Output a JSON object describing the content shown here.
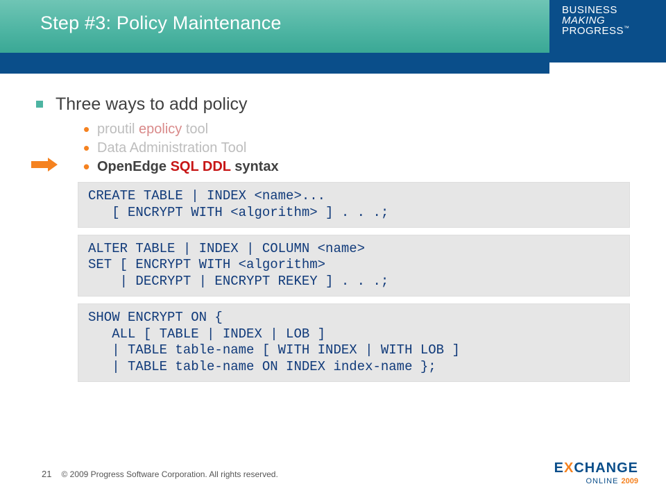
{
  "header": {
    "title": "Step #3: Policy Maintenance",
    "logo_line1": "BUSINESS",
    "logo_line2": "MAKING",
    "logo_line3": "PROGRESS",
    "logo_tm": "™"
  },
  "bullets": {
    "lvl1": "Three ways to add policy",
    "item1_pre": "proutil ",
    "item1_red": "epolicy",
    "item1_post": " tool",
    "item2": "Data Administration Tool",
    "item3_pre": "OpenEdge ",
    "item3_red": "SQL DDL",
    "item3_post": " syntax"
  },
  "code1": {
    "l1": "CREATE TABLE | INDEX <name>...",
    "l2": "   [ ENCRYPT WITH <algorithm> ] . . .;"
  },
  "code2": {
    "l1": "ALTER TABLE | INDEX | COLUMN <name>",
    "l2": "SET [ ENCRYPT WITH <algorithm>",
    "l3": "    | DECRYPT | ENCRYPT REKEY ] . . .;"
  },
  "code3": {
    "l1": "SHOW ENCRYPT ON {",
    "l2": "   ALL [ TABLE | INDEX | LOB ]",
    "l3": "   | TABLE table-name [ WITH INDEX | WITH LOB ]",
    "l4": "   | TABLE table-name ON INDEX index-name };"
  },
  "footer": {
    "page": "21",
    "copyright": "© 2009 Progress Software Corporation. All rights reserved.",
    "logo_main": "E  CHANGE",
    "logo_x": "X",
    "logo_sub": "ONLINE ",
    "logo_year": "2009"
  }
}
